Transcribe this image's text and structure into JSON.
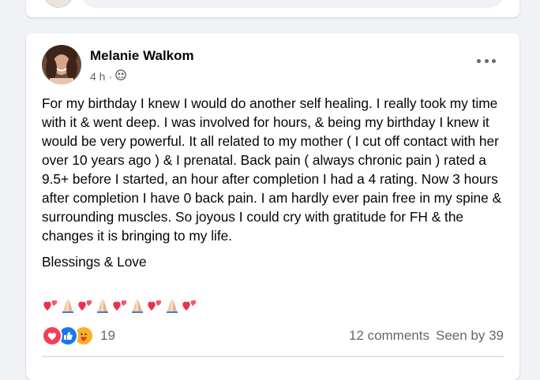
{
  "post": {
    "author": "Melanie Walkom",
    "time": "4 h",
    "separator": "·",
    "audience_icon": "group-audience-icon",
    "body_paragraphs": [
      "For my birthday I knew I would do another self healing. I really took my time with it & went deep. I was involved for hours, & being my birthday I knew it would be very powerful. It all related to my mother ( I cut off contact with her over 10 years ago ) & I prenatal. Back pain ( always chronic pain ) rated a 9.5+ before I started, an hour after completion I had a 4 rating. Now 3 hours after completion I have 0 back pain. I am hardly ever pain free in my spine & surrounding muscles. So joyous I could cry with gratitude for FH & the changes it is bringing to my life.",
      "Blessings & Love"
    ],
    "emoji_sequence": [
      "two-hearts",
      "folded-hands",
      "two-hearts",
      "folded-hands",
      "two-hearts",
      "folded-hands",
      "two-hearts",
      "folded-hands",
      "two-hearts"
    ],
    "reactions": {
      "types": [
        "love",
        "like",
        "care"
      ],
      "count": "19"
    },
    "comments": "12 comments",
    "seen_by": "Seen by 39"
  },
  "colors": {
    "love": "#f33e58",
    "like": "#1877f2",
    "care": "#f7b125",
    "accent": "#1877f2",
    "secondary_text": "#65676b"
  }
}
